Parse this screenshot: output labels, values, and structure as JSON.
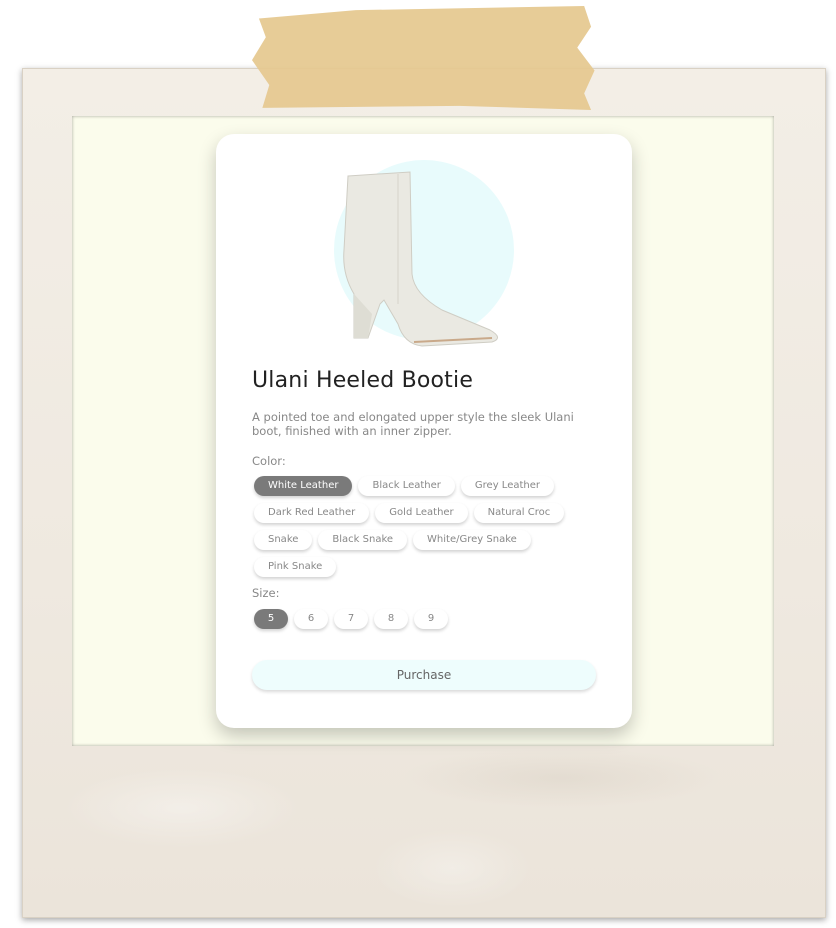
{
  "product": {
    "title": "Ulani Heeled Bootie",
    "description": "A pointed toe and elongated upper style the sleek Ulani boot, finished with an inner zipper.",
    "image_icon": "ankle-boot-image"
  },
  "color": {
    "label": "Color:",
    "selected": "White Leather",
    "options": [
      "White Leather",
      "Black Leather",
      "Grey Leather",
      "Dark Red Leather",
      "Gold Leather",
      "Natural Croc",
      "Snake",
      "Black Snake",
      "White/Grey Snake",
      "Pink Snake"
    ]
  },
  "size": {
    "label": "Size:",
    "selected": "5",
    "options": [
      "5",
      "6",
      "7",
      "8",
      "9"
    ]
  },
  "purchase_label": "Purchase",
  "colors": {
    "tape": "#e5c88f",
    "photo_background": "#fbfcec",
    "selected_chip": "#7a7a7a",
    "purchase_button": "#eefdfd",
    "image_circle": "#e8fbfc"
  }
}
